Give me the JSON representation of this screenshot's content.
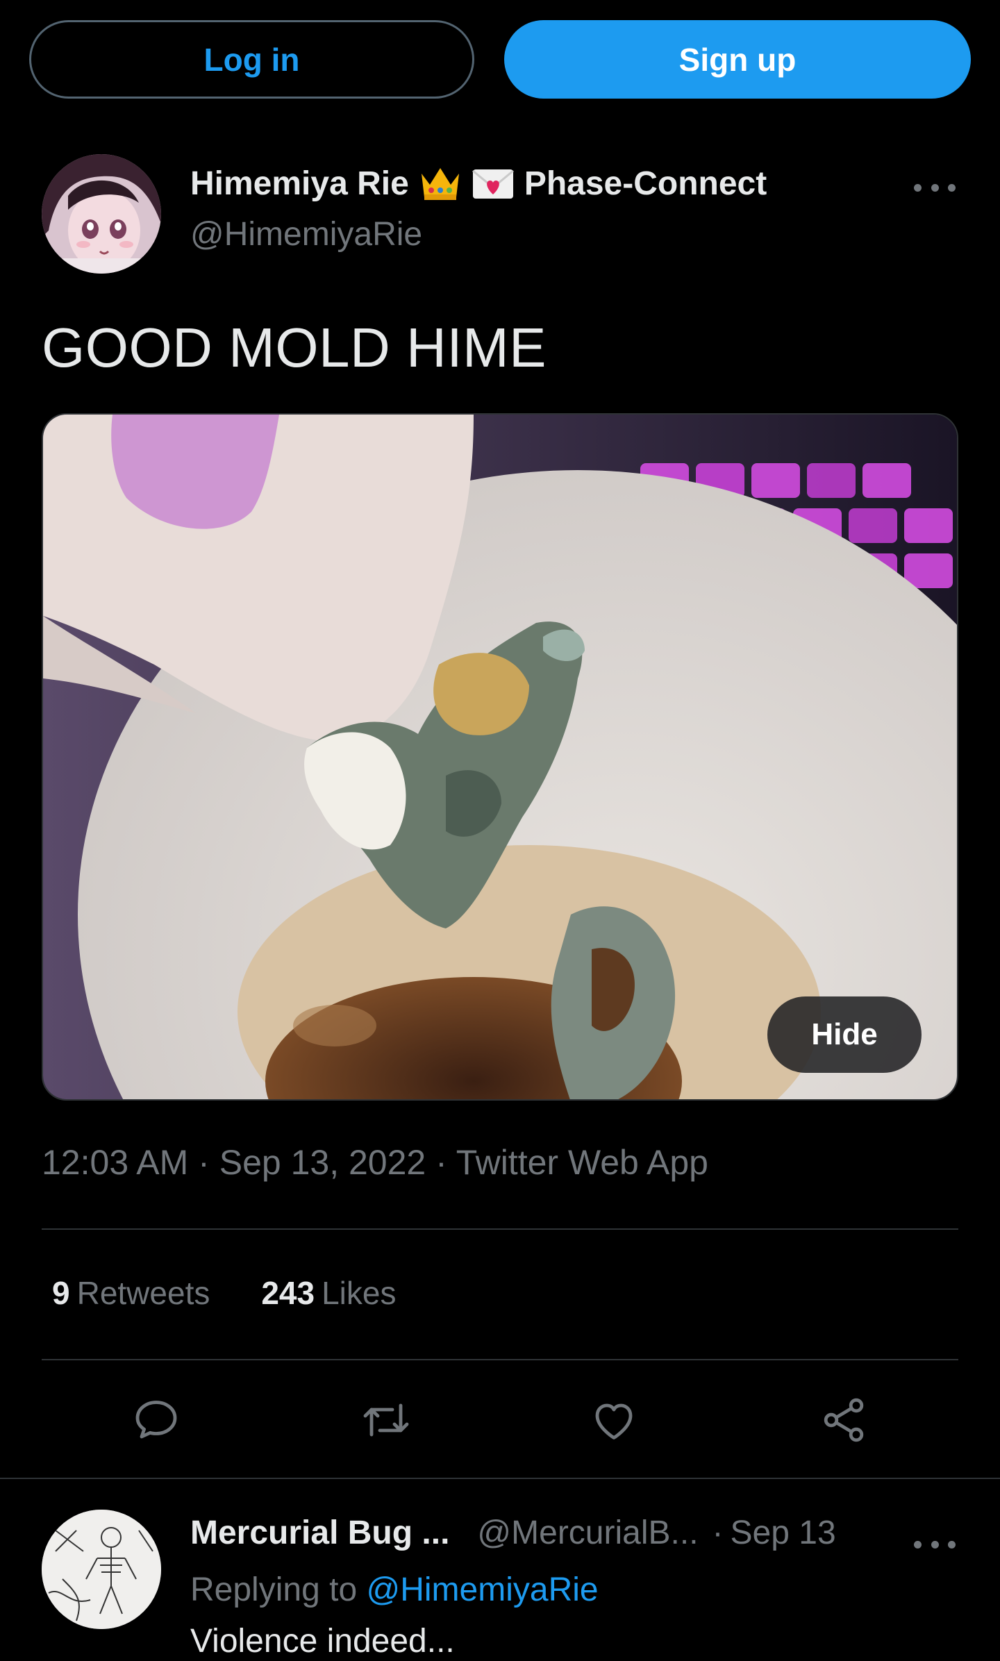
{
  "auth": {
    "login_label": "Log in",
    "signup_label": "Sign up"
  },
  "tweet": {
    "author_name": "Himemiya Rie",
    "author_name_suffix": "Phase-Connect",
    "author_emojis": [
      "crown-emoji",
      "love-letter-emoji"
    ],
    "author_handle": "@HimemiyaRie",
    "text": "GOOD MOLD HIME",
    "media_hide_label": "Hide",
    "time": "12:03 AM",
    "date": "Sep 13, 2022",
    "source": "Twitter Web App",
    "meta_sep": "·",
    "retweets_count": "9",
    "retweets_label": "Retweets",
    "likes_count": "243",
    "likes_label": "Likes",
    "actions": [
      "reply-icon",
      "retweet-icon",
      "like-icon",
      "share-icon"
    ]
  },
  "reply": {
    "author_name": "Mercurial Bug ...",
    "author_handle": "@MercurialB...",
    "sep": "·",
    "date": "Sep 13",
    "replying_prefix": "Replying to",
    "replying_to": "@HimemiyaRie",
    "text": "Violence indeed..."
  },
  "colors": {
    "background": "#000000",
    "accent": "#1d9bf0",
    "text_primary": "#e7e9ea",
    "text_secondary": "#71767b",
    "border": "#2f3336"
  }
}
